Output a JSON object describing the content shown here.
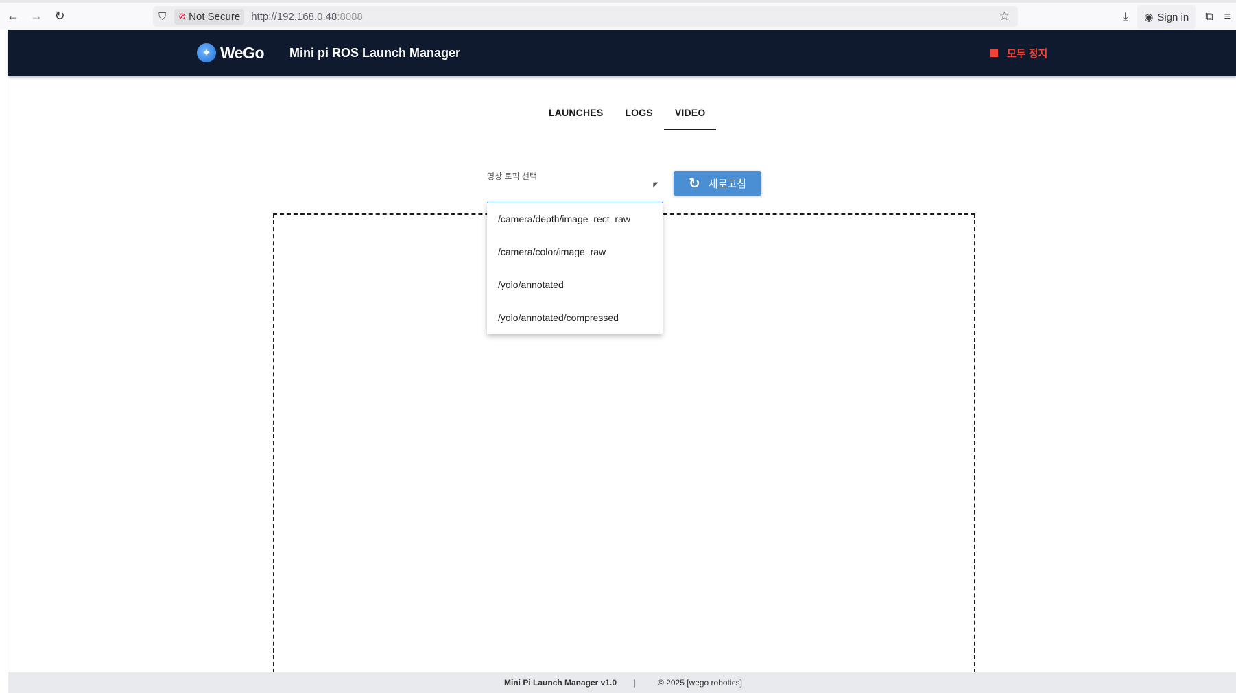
{
  "browser": {
    "back_icon": "←",
    "forward_icon": "→",
    "reload_icon": "↻",
    "shield_icon": "⛉",
    "lock_icon": "🔒",
    "not_secure": "Not Secure",
    "url_host": "http://192.168.0.48",
    "url_port": ":8088",
    "star_icon": "☆",
    "download_icon": "⤓",
    "account_icon": "◉",
    "sign_in": "Sign in",
    "extensions_icon": "⧉",
    "menu_icon": "≡"
  },
  "header": {
    "logo_text": "WeGo",
    "logo_icon": "✦",
    "title": "Mini pi ROS Launch Manager",
    "stop_all": "모두 정지",
    "stop_color": "#f44336"
  },
  "tabs": [
    {
      "label": "LAUNCHES",
      "active": false
    },
    {
      "label": "LOGS",
      "active": false
    },
    {
      "label": "VIDEO",
      "active": true
    }
  ],
  "video": {
    "select_label": "영상 토픽 선택",
    "select_arrow": "◤",
    "refresh_icon": "↻",
    "refresh_label": "새로고침",
    "options": [
      "/camera/depth/image_rect_raw",
      "/camera/color/image_raw",
      "/yolo/annotated",
      "/yolo/annotated/compressed"
    ]
  },
  "footer": {
    "app": "Mini Pi Launch Manager v1.0",
    "separator": "|",
    "copyright": "© 2025 [wego robotics]"
  }
}
